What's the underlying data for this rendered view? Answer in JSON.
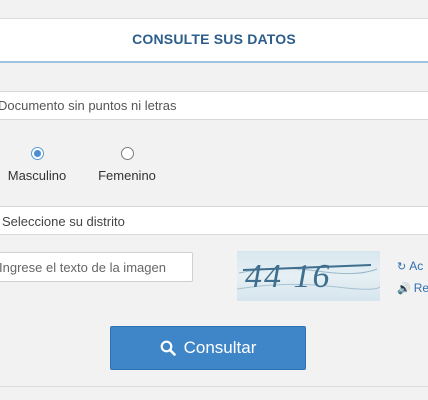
{
  "header": {
    "title": "CONSULTE SUS DATOS"
  },
  "document": {
    "placeholder": "Documento sin puntos ni letras"
  },
  "gender": {
    "options": [
      {
        "label": "Masculino",
        "checked": true
      },
      {
        "label": "Femenino",
        "checked": false
      }
    ]
  },
  "district": {
    "selected": "Seleccione su distrito"
  },
  "captcha": {
    "placeholder": "Ingrese el texto de la imagen",
    "image_text": "44 16",
    "refresh_label": "Ac",
    "audio_label": "Re"
  },
  "submit": {
    "label": "Consultar"
  },
  "colors": {
    "accent": "#3f86c8",
    "title": "#2c5d8b",
    "link": "#2f6fb0"
  }
}
